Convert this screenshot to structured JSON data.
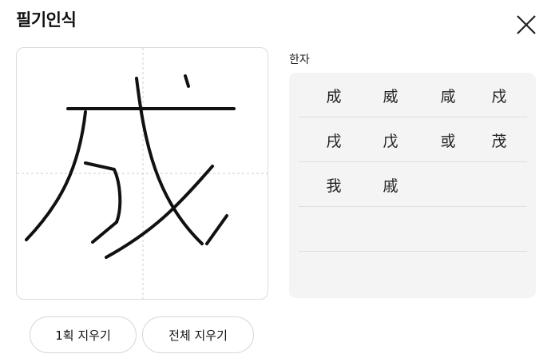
{
  "header": {
    "title": "필기인식"
  },
  "icons": {
    "close": "close-icon"
  },
  "results": {
    "label": "한자",
    "candidates": [
      "成",
      "威",
      "咸",
      "戍",
      "戌",
      "戊",
      "或",
      "茂",
      "我",
      "戚"
    ]
  },
  "actions": {
    "undo_stroke": "1획 지우기",
    "clear_all": "전체 지우기"
  },
  "colors": {
    "panel_bg": "#f4f4f4",
    "border": "#dcdcdc",
    "stroke": "#111111"
  }
}
